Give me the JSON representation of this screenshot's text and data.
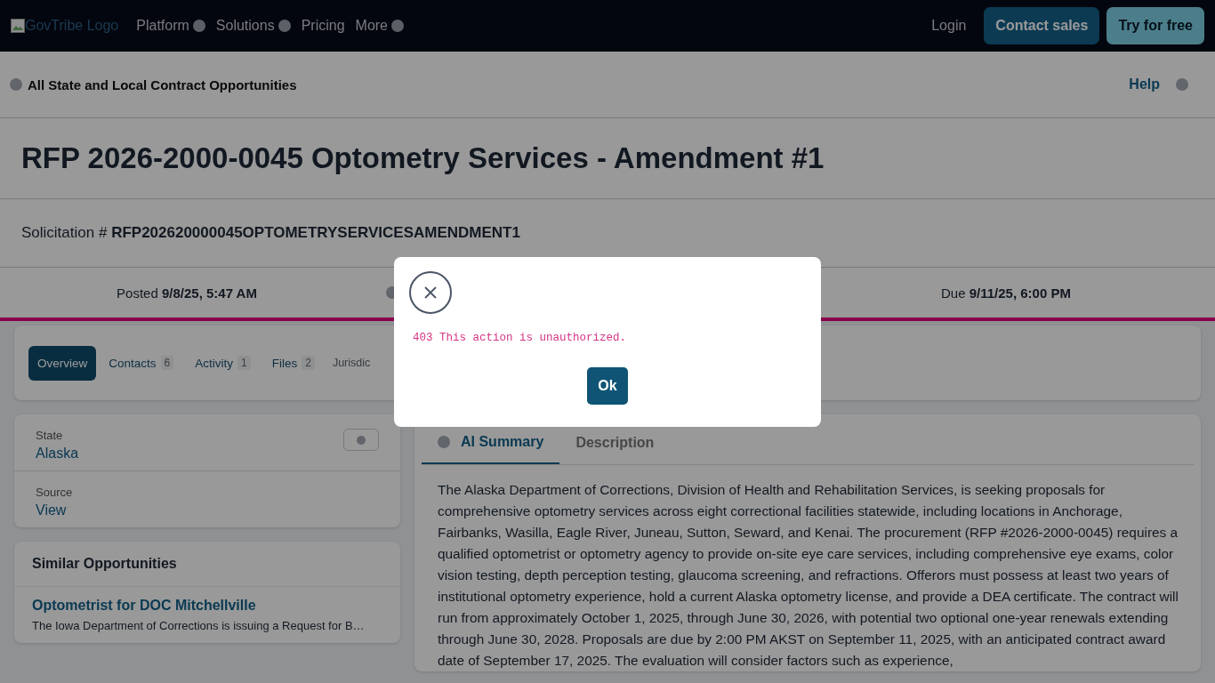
{
  "nav": {
    "logo_alt": "GovTribe Logo",
    "items": [
      {
        "label": "Platform",
        "dropdown": true
      },
      {
        "label": "Solutions",
        "dropdown": true
      },
      {
        "label": "Pricing",
        "dropdown": false
      },
      {
        "label": "More",
        "dropdown": true
      }
    ],
    "login": "Login",
    "buttons": [
      {
        "label": "Contact sales",
        "kind": "primary"
      },
      {
        "label": "Try for free",
        "kind": "secondary"
      }
    ]
  },
  "breadcrumb": {
    "label": "All State and Local Contract Opportunities",
    "help": "Help"
  },
  "title": "RFP 2026-2000-0045 Optometry Services - Amendment #1",
  "solicitation": {
    "label": "Solicitation #",
    "value": "RFP202620000045OPTOMETRYSERVICESAMENDMENT1"
  },
  "dates": [
    {
      "label": "Posted",
      "value": "9/8/25, 5:47 AM"
    },
    {
      "label": "Due",
      "value": "9/11/25, 6:00 PM"
    }
  ],
  "tabs": [
    {
      "label": "Overview",
      "selected": true
    },
    {
      "label": "Contacts",
      "count": "6",
      "selected": false
    },
    {
      "label": "Activity",
      "count": "1",
      "selected": false
    },
    {
      "label": "Files",
      "count": "2",
      "selected": false
    },
    {
      "label": "Jurisdic",
      "selected": false
    }
  ],
  "details": [
    {
      "label": "State",
      "value": "Alaska"
    },
    {
      "label": "Source",
      "value": "View"
    }
  ],
  "similar": {
    "title": "Similar Opportunities",
    "items": [
      {
        "title": "Optometrist for DOC Mitchellville",
        "description": "The Iowa Department of Corrections is issuing a Request for B…"
      }
    ]
  },
  "summary_tabs": [
    {
      "label": "AI Summary",
      "selected": true
    },
    {
      "label": "Description",
      "selected": false
    }
  ],
  "summary": "The Alaska Department of Corrections, Division of Health and Rehabilitation Services, is seeking proposals for comprehensive optometry services across eight correctional facilities statewide, including locations in Anchorage, Fairbanks, Wasilla, Eagle River, Juneau, Sutton, Seward, and Kenai. The procurement (RFP #2026-2000-0045) requires a qualified optometrist or optometry agency to provide on-site eye care services, including comprehensive eye exams, color vision testing, depth perception testing, glaucoma screening, and refractions. Offerors must possess at least two years of institutional optometry experience, hold a current Alaska optometry license, and provide a DEA certificate. The contract will run from approximately October 1, 2025, through June 30, 2026, with potential two optional one-year renewals extending through June 30, 2028. Proposals are due by 2:00 PM AKST on September 11, 2025, with an anticipated contract award date of September 17, 2025. The evaluation will consider factors such as experience,",
  "modal": {
    "message": "403 This action is unauthorized.",
    "button": "Ok"
  }
}
